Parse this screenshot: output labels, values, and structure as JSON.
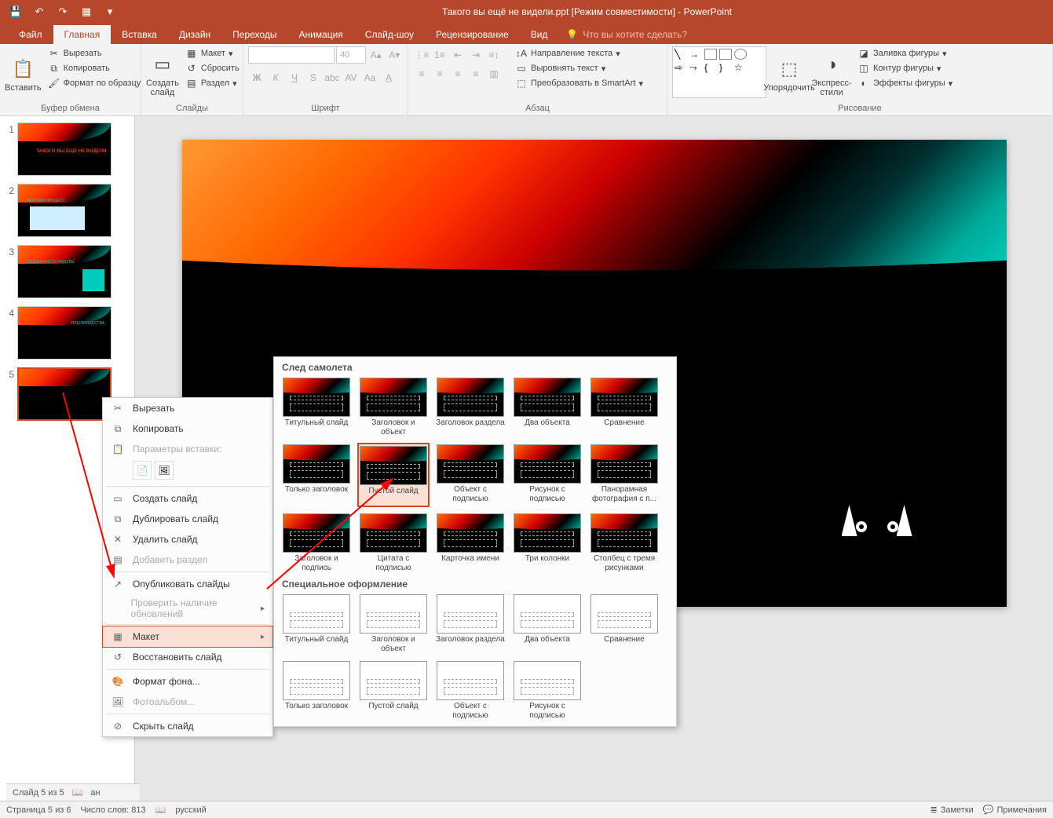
{
  "title": "Такого вы ещё не видели.ppt [Режим совместимости] - PowerPoint",
  "qat": {
    "save": "💾",
    "undo": "↶",
    "redo": "↷",
    "start": "▦"
  },
  "tabs": {
    "file": "Файл",
    "home": "Главная",
    "insert": "Вставка",
    "design": "Дизайн",
    "transitions": "Переходы",
    "animations": "Анимация",
    "slideshow": "Слайд-шоу",
    "review": "Рецензирование",
    "view": "Вид",
    "tellme": "Что вы хотите сделать?"
  },
  "ribbon": {
    "clipboard": {
      "label": "Буфер обмена",
      "paste": "Вставить",
      "cut": "Вырезать",
      "copy": "Копировать",
      "format_painter": "Формат по образцу"
    },
    "slides": {
      "label": "Слайды",
      "new_slide": "Создать\nслайд",
      "layout": "Макет",
      "reset": "Сбросить",
      "section": "Раздел"
    },
    "font": {
      "label": "Шрифт",
      "size": "40"
    },
    "paragraph": {
      "label": "Абзац",
      "text_dir": "Направление текста",
      "align_text": "Выровнять текст",
      "smartart": "Преобразовать в SmartArt"
    },
    "drawing": {
      "label": "Рисование",
      "arrange": "Упорядочить",
      "quick_styles": "Экспресс-\nстили",
      "fill": "Заливка фигуры",
      "outline": "Контур фигуры",
      "effects": "Эффекты фигуры"
    }
  },
  "thumbs": [
    "1",
    "2",
    "3",
    "4",
    "5"
  ],
  "thumb_titles": {
    "t1": "ТАКОГО ВЫ ЕЩЁ НЕ ВИДЕЛИ",
    "t2": "РАБОЧИЙ ПРОЦЕСС",
    "t3": "ОСОБЕННОСТИ РАБОТЫ",
    "t4": "ПРЕИМУЩЕСТВА"
  },
  "context_menu": {
    "cut": "Вырезать",
    "copy": "Копировать",
    "paste_header": "Параметры вставки:",
    "new_slide": "Создать слайд",
    "duplicate": "Дублировать слайд",
    "delete": "Удалить слайд",
    "add_section": "Добавить раздел",
    "publish": "Опубликовать слайды",
    "check_updates": "Проверить наличие обновлений",
    "layout": "Макет",
    "reset": "Восстановить слайд",
    "format_bg": "Формат фона...",
    "photo_album": "Фотоальбом...",
    "hide": "Скрыть слайд"
  },
  "layout_flyout": {
    "section1": "След самолета",
    "section2": "Специальное оформление",
    "items_dark": [
      "Титульный слайд",
      "Заголовок и объект",
      "Заголовок раздела",
      "Два объекта",
      "Сравнение",
      "Только заголовок",
      "Пустой слайд",
      "Объект с подписью",
      "Рисунок с подписью",
      "Панорамная фотография с п...",
      "Заголовок и подпись",
      "Цитата с подписью",
      "Карточка имени",
      "Три колонки",
      "Столбец с тремя рисунками"
    ],
    "items_white": [
      "Титульный слайд",
      "Заголовок и объект",
      "Заголовок раздела",
      "Два объекта",
      "Сравнение",
      "Только заголовок",
      "Пустой слайд",
      "Объект с подписью",
      "Рисунок с подписью"
    ]
  },
  "status": {
    "slide": "Слайд 5 из 5",
    "page": "Страница 5 из 6",
    "words": "Число слов: 813",
    "lang": "русский",
    "notes": "Заметки",
    "comments": "Примечания",
    "an": "ан"
  }
}
